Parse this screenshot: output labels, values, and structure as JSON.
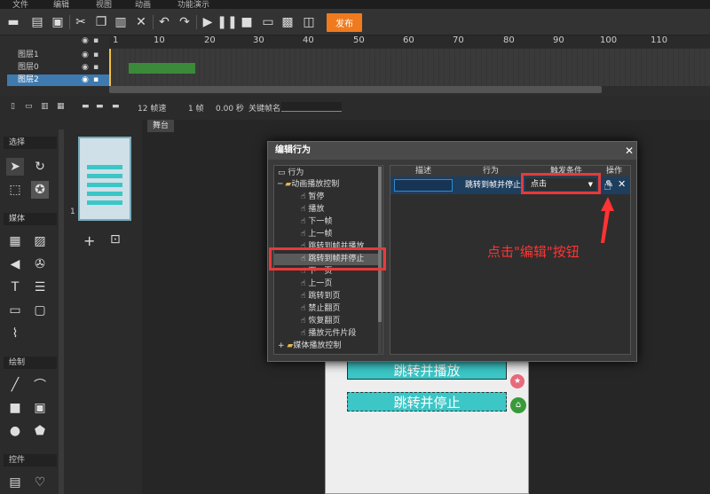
{
  "menu": [
    "文件",
    "编辑",
    "视图",
    "动画",
    "功能演示"
  ],
  "toolbar": {
    "publish_label": "发布"
  },
  "layers": [
    {
      "name": "图层1"
    },
    {
      "name": "图层0"
    },
    {
      "name": "图层2"
    }
  ],
  "ruler_ticks": [
    "1",
    "10",
    "20",
    "30",
    "40",
    "50",
    "60",
    "70",
    "80",
    "90",
    "100",
    "110"
  ],
  "timeline_status": {
    "fps": "12 帧速",
    "frame": "1 帧",
    "time": "0.00 秒",
    "frame_name_label": "关键帧名"
  },
  "tools": {
    "select_section": "选择",
    "media_section": "媒体",
    "draw_section": "绘制",
    "control_section": "控件"
  },
  "pages": {
    "page_number": "1"
  },
  "stage": {
    "tab_label": "舞台",
    "buttons": [
      "跳转并播放",
      "跳转并停止"
    ]
  },
  "dialog": {
    "title": "编辑行为",
    "close_glyph": "✕",
    "tree": {
      "root": "行为",
      "group": "动画播放控制",
      "items": [
        "暂停",
        "播放",
        "下一帧",
        "上一帧",
        "跳转到帧并播放",
        "跳转到帧并停止",
        "下一页",
        "上一页",
        "跳转到页",
        "禁止翻页",
        "恢复翻页",
        "播放元件片段"
      ],
      "group2": "媒体播放控制"
    },
    "table": {
      "headers": [
        "描述",
        "行为",
        "触发条件",
        "操作"
      ],
      "row": {
        "description": "",
        "action": "跳转到帧并停止",
        "trigger": "点击"
      }
    }
  },
  "annotation": {
    "text": "点击\"编辑\"按钮"
  },
  "colors": {
    "accent": "#f07a1e",
    "highlight": "#e63a3a",
    "teal": "#3cc6c6"
  }
}
